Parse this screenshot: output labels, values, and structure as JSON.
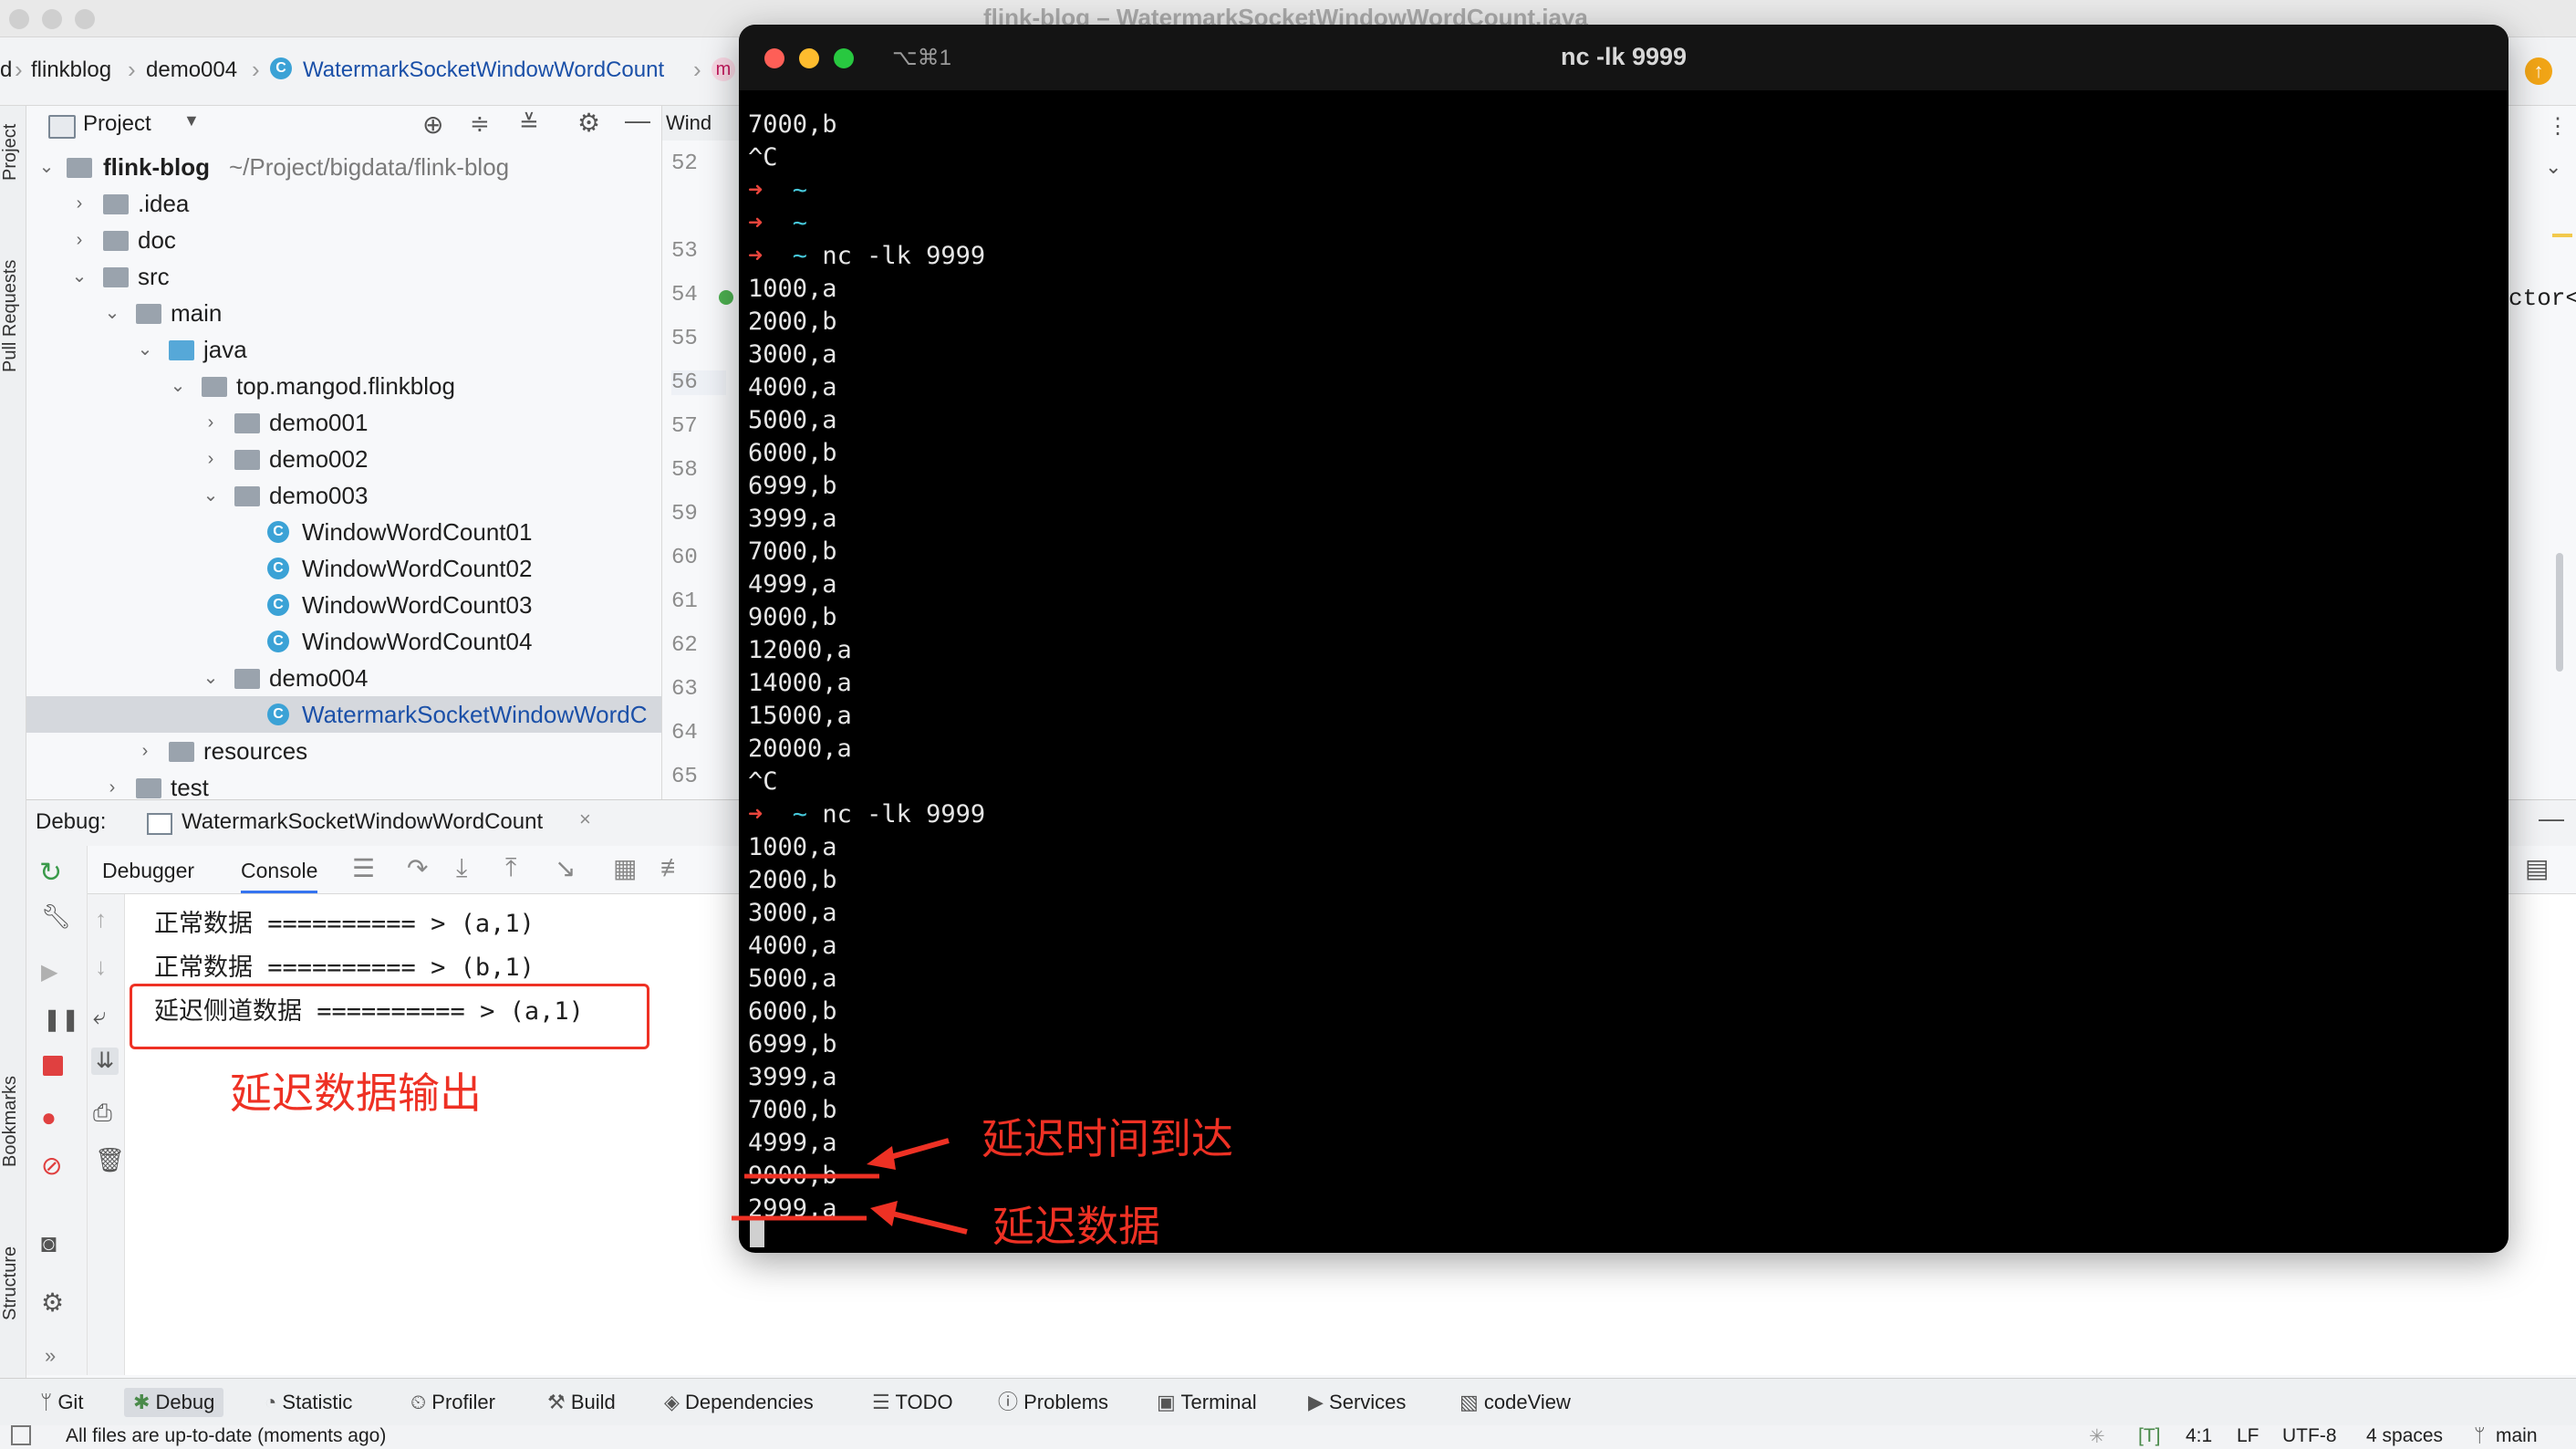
{
  "window": {
    "title": "flink-blog – WatermarkSocketWindowWordCount.java"
  },
  "breadcrumb": [
    "d",
    "flinkblog",
    "demo004",
    "WatermarkSocketWindowWordCount",
    "m"
  ],
  "left_stripe": {
    "project": "Project",
    "pull_requests": "Pull Requests",
    "bookmarks": "Bookmarks",
    "structure": "Structure"
  },
  "project_panel": {
    "title": "Project",
    "tree": [
      {
        "label": "flink-blog",
        "hint": "~/Project/bigdata/flink-blog"
      },
      {
        "label": ".idea"
      },
      {
        "label": "doc"
      },
      {
        "label": "src"
      },
      {
        "label": "main"
      },
      {
        "label": "java"
      },
      {
        "label": "top.mangod.flinkblog"
      },
      {
        "label": "demo001"
      },
      {
        "label": "demo002"
      },
      {
        "label": "demo003"
      },
      {
        "label": "WindowWordCount01"
      },
      {
        "label": "WindowWordCount02"
      },
      {
        "label": "WindowWordCount03"
      },
      {
        "label": "WindowWordCount04"
      },
      {
        "label": "demo004"
      },
      {
        "label": "WatermarkSocketWindowWordC"
      },
      {
        "label": "resources"
      },
      {
        "label": "test"
      }
    ]
  },
  "editor": {
    "tab_label": "Wind",
    "line_numbers": [
      "52",
      "53",
      "54",
      "55",
      "56",
      "57",
      "58",
      "59",
      "60",
      "61",
      "62",
      "63",
      "64",
      "65"
    ],
    "code_fragment": "ctor<"
  },
  "debug": {
    "label": "Debug:",
    "session": "WatermarkSocketWindowWordCount",
    "tabs": {
      "debugger": "Debugger",
      "console": "Console"
    },
    "console_lines": [
      "正常数据 ========== > (a,1)",
      "正常数据 ========== > (b,1)",
      "延迟侧道数据 ========== > (a,1)"
    ]
  },
  "terminal": {
    "shortcut": "⌥⌘1",
    "title": "nc -lk 9999",
    "lines": [
      {
        "text": "7000,b"
      },
      {
        "text": "^C"
      },
      {
        "prompt": true,
        "cmd": ""
      },
      {
        "prompt": true,
        "cmd": ""
      },
      {
        "prompt": true,
        "cmd": "nc -lk 9999"
      },
      {
        "text": "1000,a"
      },
      {
        "text": "2000,b"
      },
      {
        "text": "3000,a"
      },
      {
        "text": "4000,a"
      },
      {
        "text": "5000,a"
      },
      {
        "text": "6000,b"
      },
      {
        "text": "6999,b"
      },
      {
        "text": "3999,a"
      },
      {
        "text": "7000,b"
      },
      {
        "text": "4999,a"
      },
      {
        "text": "9000,b"
      },
      {
        "text": "12000,a"
      },
      {
        "text": "14000,a"
      },
      {
        "text": "15000,a"
      },
      {
        "text": "20000,a"
      },
      {
        "text": "^C"
      },
      {
        "prompt": true,
        "cmd": "nc -lk 9999"
      },
      {
        "text": "1000,a"
      },
      {
        "text": "2000,b"
      },
      {
        "text": "3000,a"
      },
      {
        "text": "4000,a"
      },
      {
        "text": "5000,a"
      },
      {
        "text": "6000,b"
      },
      {
        "text": "6999,b"
      },
      {
        "text": "3999,a"
      },
      {
        "text": "7000,b"
      },
      {
        "text": "4999,a"
      },
      {
        "text": "9000,b"
      },
      {
        "text": "2999,a"
      }
    ],
    "prompt_arrow": "➜",
    "prompt_dir": "~"
  },
  "annotations": {
    "late_output": "延迟数据输出",
    "late_time_arrived": "延迟时间到达",
    "late_data": "延迟数据"
  },
  "tool_windows": [
    "Git",
    "Debug",
    "Statistic",
    "Profiler",
    "Build",
    "Dependencies",
    "TODO",
    "Problems",
    "Terminal",
    "Services",
    "codeView"
  ],
  "status_bar": {
    "message": "All files are up-to-date (moments ago)",
    "position": "4:1",
    "line_sep": "LF",
    "encoding": "UTF-8",
    "indent": "4 spaces",
    "branch": "main"
  },
  "colors": {
    "accent_red": "#ee3124",
    "terminal_bg": "#000000",
    "class_icon": "#3ba2d6",
    "folder": "#9aa3ad"
  }
}
